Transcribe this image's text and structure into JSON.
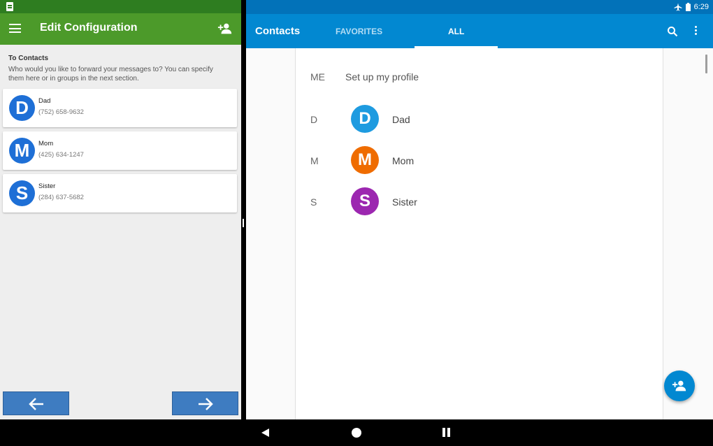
{
  "left_app": {
    "title": "Edit Configuration",
    "icons": {
      "menu": "menu-icon",
      "add_contact": "person-add-icon",
      "status_notification": "notification-icon"
    },
    "section_heading": "To Contacts",
    "section_description": "Who would you like to forward your messages to? You can specify them here or in groups in the next section.",
    "contacts": [
      {
        "initial": "D",
        "name": "Dad",
        "phone": "(752) 658-9632"
      },
      {
        "initial": "M",
        "name": "Mom",
        "phone": "(425) 634-1247"
      },
      {
        "initial": "S",
        "name": "Sister",
        "phone": "(284) 637-5682"
      }
    ],
    "nav": {
      "back_icon": "arrow-left-icon",
      "next_icon": "arrow-right-icon"
    },
    "colors": {
      "status_bar": "#2e7d20",
      "app_bar": "#4c9a2a",
      "avatar": "#1e6fd6",
      "nav_button": "#3e7cc1"
    }
  },
  "right_app": {
    "status_bar": {
      "time": "6:29",
      "icons": [
        "airplane-mode-icon",
        "battery-icon"
      ]
    },
    "title": "Contacts",
    "tabs": [
      {
        "label": "FAVORITES",
        "selected": false
      },
      {
        "label": "ALL",
        "selected": true
      }
    ],
    "icons": {
      "search": "search-icon",
      "more": "more-vert-icon",
      "fab": "person-add-icon"
    },
    "me": {
      "letter": "ME",
      "label": "Set up my profile"
    },
    "contacts": [
      {
        "letter": "D",
        "initial": "D",
        "name": "Dad",
        "color": "#1e9be0"
      },
      {
        "letter": "M",
        "initial": "M",
        "name": "Mom",
        "color": "#ef6c00"
      },
      {
        "letter": "S",
        "initial": "S",
        "name": "Sister",
        "color": "#9c27b0"
      }
    ],
    "colors": {
      "status_bar": "#0272b9",
      "app_bar": "#0288d1",
      "fab": "#0288d1"
    }
  },
  "system_nav": {
    "back": "back-triangle-icon",
    "home": "home-circle-icon",
    "recents": "recents-icon"
  }
}
